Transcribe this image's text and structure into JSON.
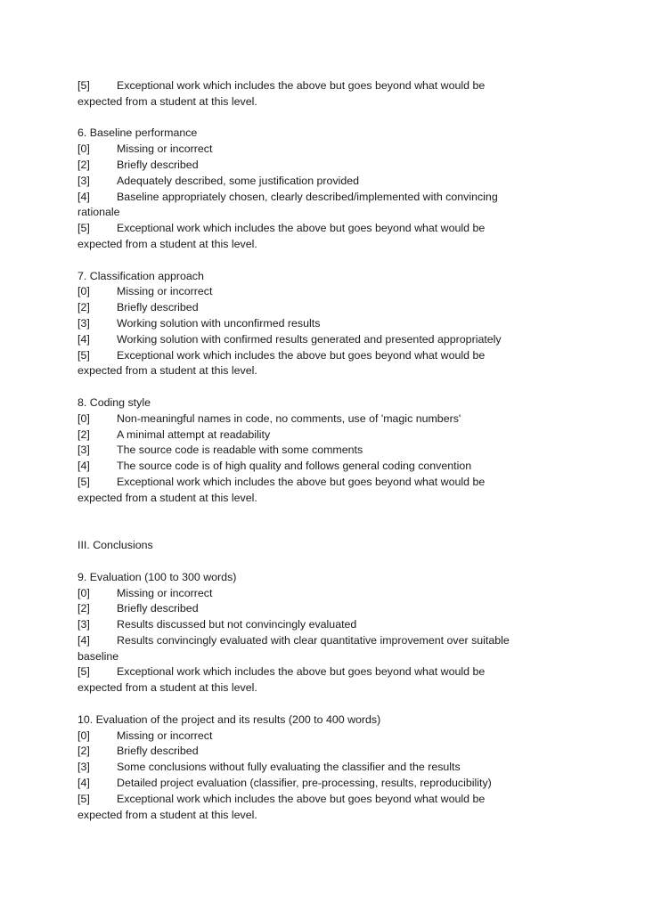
{
  "intro": {
    "mark": "[5]",
    "text": "Exceptional work which includes the above but goes beyond what would be",
    "cont": "expected from a student at this level."
  },
  "sections": [
    {
      "heading": "6. Baseline performance",
      "items": [
        {
          "mark": "[0]",
          "text": "Missing or incorrect"
        },
        {
          "mark": "[2]",
          "text": "Briefly described"
        },
        {
          "mark": "[3]",
          "text": "Adequately described, some justification provided"
        },
        {
          "mark": "[4]",
          "text": "Baseline appropriately chosen, clearly described/implemented with convincing",
          "cont": "rationale"
        },
        {
          "mark": "[5]",
          "text": "Exceptional work which includes the above but goes beyond what would be",
          "cont": "expected from a student at this level."
        }
      ]
    },
    {
      "heading": "7. Classification approach",
      "items": [
        {
          "mark": "[0]",
          "text": "Missing or incorrect"
        },
        {
          "mark": "[2]",
          "text": "Briefly described"
        },
        {
          "mark": "[3]",
          "text": "Working solution with unconfirmed results"
        },
        {
          "mark": "[4]",
          "text": "Working solution with confirmed results generated and presented appropriately"
        },
        {
          "mark": "[5]",
          "text": "Exceptional work which includes the above but goes beyond what would be",
          "cont": "expected from a student at this level."
        }
      ]
    },
    {
      "heading": "8. Coding style",
      "items": [
        {
          "mark": "[0]",
          "text": "Non-meaningful names in code, no comments, use of 'magic numbers'"
        },
        {
          "mark": "[2]",
          "text": "A minimal attempt at readability"
        },
        {
          "mark": "[3]",
          "text": "The source code is readable with some comments"
        },
        {
          "mark": "[4]",
          "text": "The source code is of high quality and follows general coding convention"
        },
        {
          "mark": "[5]",
          "text": "Exceptional work which includes the above but goes beyond what would be",
          "cont": "expected from a student at this level."
        }
      ]
    },
    {
      "heading": "9. Evaluation (100 to 300 words)",
      "items": [
        {
          "mark": "[0]",
          "text": "Missing or incorrect"
        },
        {
          "mark": "[2]",
          "text": "Briefly described"
        },
        {
          "mark": "[3]",
          "text": "Results discussed but not convincingly evaluated"
        },
        {
          "mark": "[4]",
          "text": "Results convincingly evaluated with clear quantitative improvement over suitable",
          "cont": "baseline"
        },
        {
          "mark": "[5]",
          "text": "Exceptional work which includes the above but goes beyond what would be",
          "cont": "expected from a student at this level."
        }
      ]
    },
    {
      "heading": "10. Evaluation of the project and its results (200 to 400 words)",
      "items": [
        {
          "mark": "[0]",
          "text": "Missing or incorrect"
        },
        {
          "mark": "[2]",
          "text": "Briefly described"
        },
        {
          "mark": "[3]",
          "text": "Some conclusions without fully evaluating the classifier and the results"
        },
        {
          "mark": "[4]",
          "text": "Detailed project evaluation (classifier, pre-processing, results, reproducibility)"
        },
        {
          "mark": "[5]",
          "text": "Exceptional work which includes the above but goes beyond what would be",
          "cont": "expected from a student at this level."
        }
      ]
    }
  ],
  "part_heading": "III. Conclusions"
}
